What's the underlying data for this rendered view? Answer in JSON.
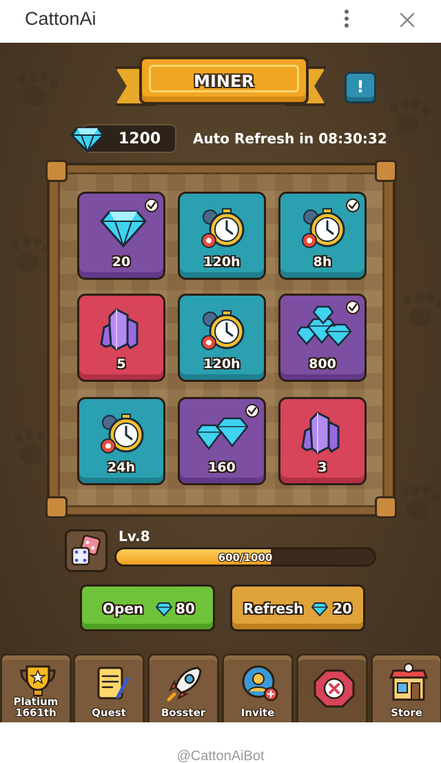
{
  "window": {
    "title": "CattonAi"
  },
  "header": {
    "title": "MINER",
    "info_label": "!"
  },
  "balance": {
    "gems": "1200",
    "refresh_text": "Auto Refresh in 08:30:32"
  },
  "grid": [
    {
      "label": "20",
      "color": "purple",
      "icon": "diamond-icon",
      "checked": true
    },
    {
      "label": "120h",
      "color": "teal",
      "icon": "stopwatch-icon",
      "checked": false
    },
    {
      "label": "8h",
      "color": "teal",
      "icon": "stopwatch-icon",
      "checked": true
    },
    {
      "label": "5",
      "color": "red",
      "icon": "crystal-icon",
      "checked": false
    },
    {
      "label": "120h",
      "color": "teal",
      "icon": "stopwatch-icon",
      "checked": false
    },
    {
      "label": "800",
      "color": "purple",
      "icon": "diamond-pile-icon",
      "checked": true
    },
    {
      "label": "24h",
      "color": "teal",
      "icon": "stopwatch-icon",
      "checked": false
    },
    {
      "label": "160",
      "color": "purple",
      "icon": "diamond-pair-icon",
      "checked": true
    },
    {
      "label": "3",
      "color": "red",
      "icon": "crystal-icon",
      "checked": false
    }
  ],
  "level": {
    "label": "Lv.8",
    "progress_text": "600/1000",
    "progress": 0.6
  },
  "actions": {
    "open": {
      "label": "Open",
      "cost": "80"
    },
    "refresh": {
      "label": "Refresh",
      "cost": "20"
    }
  },
  "nav": {
    "platium": "Platium\n1661th",
    "quest": "Quest",
    "bosster": "Bosster",
    "invite": "Invite",
    "store": "Store"
  },
  "footer": {
    "text": "@CattonAiBot"
  },
  "colors": {
    "purple": "#7d4fa3",
    "teal": "#2aa0b0",
    "red": "#d8445a",
    "accent": "#f0a623",
    "gem": "#3fd3f0"
  }
}
